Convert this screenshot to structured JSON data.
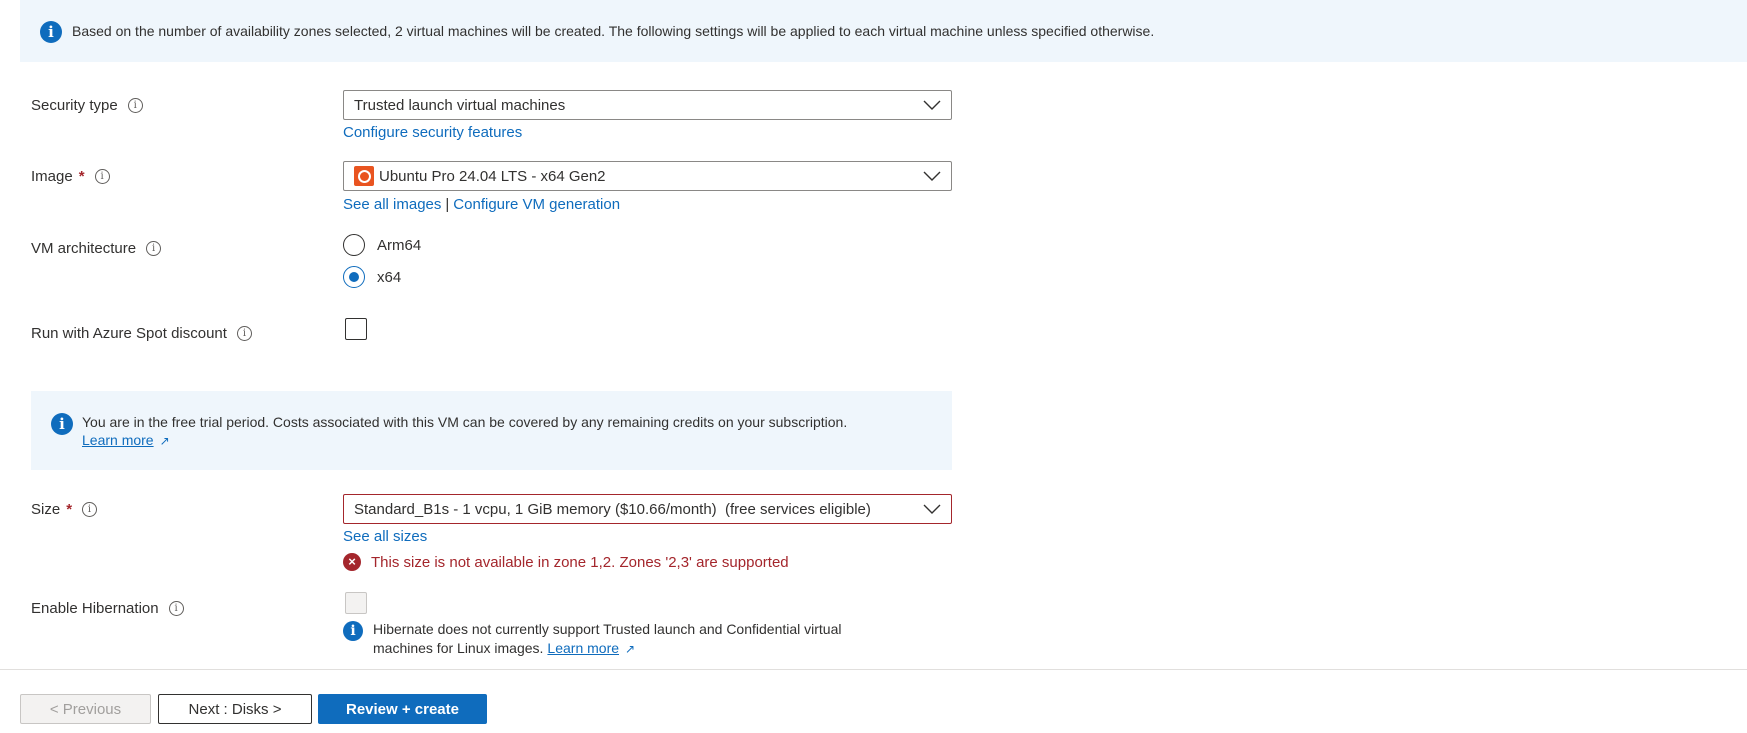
{
  "colors": {
    "accent": "#0f6cbd",
    "error": "#a4262c",
    "info_bg": "#eff6fc",
    "ubuntu": "#e95420"
  },
  "top_banner": {
    "icon": "info-icon",
    "message": "Based on the number of availability zones selected, 2 virtual machines will be created. The following settings will be applied to each virtual machine unless specified otherwise."
  },
  "security_type": {
    "label": "Security type",
    "value": "Trusted launch virtual machines",
    "link": "Configure security features"
  },
  "image": {
    "label": "Image",
    "required_mark": "*",
    "value": "Ubuntu Pro 24.04 LTS - x64 Gen2",
    "icon": "ubuntu-icon",
    "link_all": "See all images",
    "separator": "|",
    "link_config": "Configure VM generation"
  },
  "vm_architecture": {
    "label": "VM architecture",
    "options": [
      "Arm64",
      "x64"
    ],
    "selected": "x64"
  },
  "spot": {
    "label": "Run with Azure Spot discount",
    "checked": false
  },
  "trial_banner": {
    "message": "You are in the free trial period. Costs associated with this VM can be covered by any remaining credits on your subscription.",
    "link": "Learn more"
  },
  "size": {
    "label": "Size",
    "required_mark": "*",
    "value": "Standard_B1s - 1 vcpu, 1 GiB memory ($10.66/month)  (free services eligible)",
    "link": "See all sizes",
    "error": "This size is not available in zone 1,2. Zones '2,3' are supported"
  },
  "hibernation": {
    "label": "Enable Hibernation",
    "checked": false,
    "note": "Hibernate does not currently support Trusted launch and Confidential virtual machines for Linux images.",
    "link": "Learn more"
  },
  "footer": {
    "previous": "< Previous",
    "next": "Next : Disks >",
    "review": "Review + create"
  }
}
